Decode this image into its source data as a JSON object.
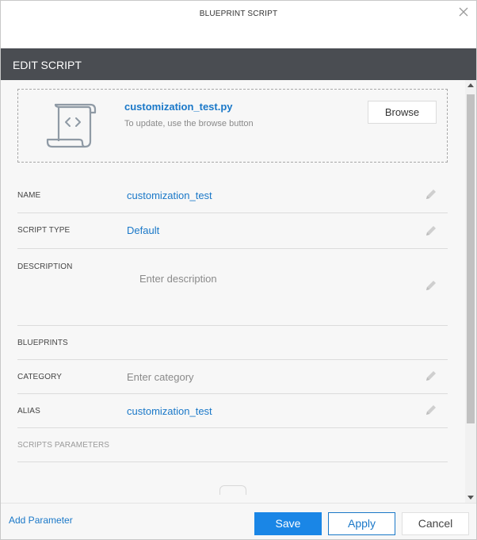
{
  "window": {
    "title": "BLUEPRINT SCRIPT"
  },
  "header": {
    "label": "EDIT SCRIPT"
  },
  "upload": {
    "file_name": "customization_test.py",
    "hint": "To update, use the browse button",
    "browse_label": "Browse"
  },
  "fields": {
    "name": {
      "label": "NAME",
      "value": "customization_test"
    },
    "script_type": {
      "label": "SCRIPT TYPE",
      "value": "Default"
    },
    "description": {
      "label": "DESCRIPTION",
      "placeholder": "Enter description"
    },
    "blueprints": {
      "label": "BLUEPRINTS"
    },
    "category": {
      "label": "CATEGORY",
      "placeholder": "Enter category"
    },
    "alias": {
      "label": "ALIAS",
      "value": "customization_test"
    },
    "scripts_parameters": {
      "label": "SCRIPTS PARAMETERS"
    }
  },
  "footer": {
    "add_parameter": "Add Parameter",
    "save_label": "Save",
    "apply_label": "Apply",
    "cancel_label": "Cancel"
  },
  "colors": {
    "accent": "#1a78c8",
    "primary_button": "#1a86e6",
    "header_bg": "#4a4d52"
  },
  "icons": {
    "close": "close-icon",
    "file": "script-file-icon",
    "edit": "pencil-icon"
  }
}
